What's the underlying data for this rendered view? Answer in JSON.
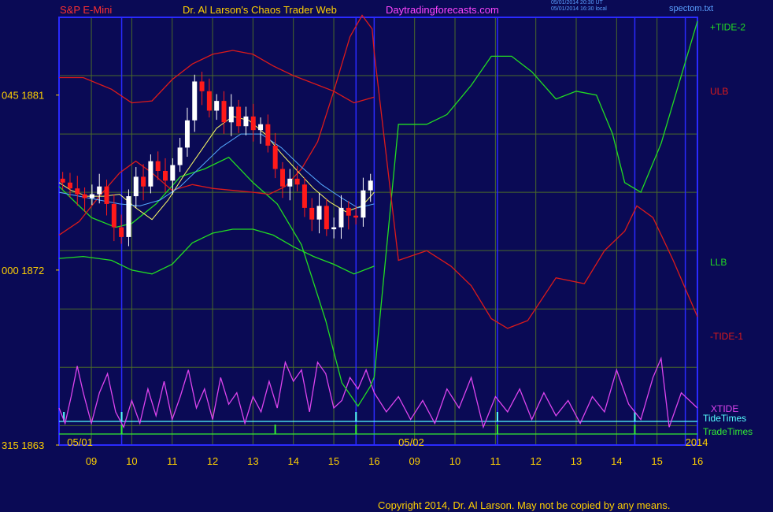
{
  "header": {
    "symbol": "S&P E-Mini",
    "site": "Dr. Al Larson's Chaos Trader Web",
    "url": "Daytradingforecasts.com",
    "stamp_ut": "05/01/2014 20:30 UT",
    "stamp_local": "05/01/2014 16:30 local",
    "file": "spectom.txt"
  },
  "copyright": "Copyright 2014, Dr. Al Larson. May not be copied by any means.",
  "colors": {
    "background": "#0a0a55",
    "frame": "#2a2aff",
    "grid": "#4a6a2a",
    "up_candle": "#ffffff",
    "down_candle": "#ff1a1a",
    "tide_plus": "#22dd22",
    "tide_minus": "#dd1a1a",
    "xtide": "#dd44ee",
    "ma_fast": "#ffff66",
    "ma_slow": "#55aaff",
    "tide_times": "#55ffff",
    "trade_times": "#33ee33",
    "header_red": "#ff3030",
    "header_yellow": "#ffd000",
    "header_magenta": "#ff44ff"
  },
  "chart_data": {
    "type": "line",
    "title": "S&P E-Mini",
    "ylabel": "",
    "ylim": [
      1863,
      1885
    ],
    "xlim": [
      8.2,
      24.0
    ],
    "y_ticks": [
      {
        "value": 1881,
        "label": "045  1881"
      },
      {
        "value": 1872,
        "label": "000  1872"
      },
      {
        "value": 1863,
        "label": "315  1863"
      }
    ],
    "x_ticks": [
      {
        "x": 9,
        "label": "09"
      },
      {
        "x": 10,
        "label": "10"
      },
      {
        "x": 11,
        "label": "11"
      },
      {
        "x": 12,
        "label": "12"
      },
      {
        "x": 13,
        "label": "13"
      },
      {
        "x": 14,
        "label": "14"
      },
      {
        "x": 15,
        "label": "15"
      },
      {
        "x": 16,
        "label": "16"
      },
      {
        "x": 17,
        "label": "09"
      },
      {
        "x": 18,
        "label": "10"
      },
      {
        "x": 19,
        "label": "11"
      },
      {
        "x": 20,
        "label": "12"
      },
      {
        "x": 21,
        "label": "13"
      },
      {
        "x": 22,
        "label": "14"
      },
      {
        "x": 23,
        "label": "15"
      },
      {
        "x": 24,
        "label": "16"
      }
    ],
    "date_labels": [
      {
        "x": 8.4,
        "label": "05/01"
      },
      {
        "x": 16.6,
        "label": "05/02"
      },
      {
        "x": 23.7,
        "label": "2014"
      }
    ],
    "right_labels": [
      {
        "text": "+TIDE-2",
        "y": 1884.5,
        "color": "#22dd22"
      },
      {
        "text": "ULB",
        "y": 1881.2,
        "color": "#dd1a1a"
      },
      {
        "text": "LLB",
        "y": 1872.4,
        "color": "#22dd22"
      },
      {
        "text": "-TIDE-1",
        "y": 1868.6,
        "color": "#dd1a1a"
      }
    ],
    "indicator_labels": [
      {
        "text": "XTIDE",
        "color": "#dd44ee"
      },
      {
        "text": "TideTimes",
        "color": "#55ffff"
      },
      {
        "text": "TradeTimes",
        "color": "#33ee33"
      }
    ],
    "grid": true,
    "price_candles_x": [
      8.2,
      16.0
    ],
    "price_close": [
      1876.5,
      1876.2,
      1875.9,
      1875.7,
      1875.9,
      1876.3,
      1875.4,
      1874.2,
      1873.7,
      1875.8,
      1876.8,
      1876.3,
      1877.6,
      1877.1,
      1876.6,
      1877.4,
      1878.3,
      1879.7,
      1881.7,
      1881.2,
      1880.2,
      1880.7,
      1879.6,
      1880.4,
      1879.4,
      1879.9,
      1879.2,
      1879.5,
      1878.4,
      1877.2,
      1876.3,
      1876.7,
      1876.4,
      1875.2,
      1874.6,
      1875.3,
      1874.1,
      1874.2,
      1875.2,
      1874.8,
      1874.7,
      1876.1,
      1876.6
    ],
    "series": [
      {
        "name": "ULB",
        "color": "#dd1a1a",
        "x": [
          8.2,
          8.8,
          9.5,
          10.0,
          10.5,
          11.0,
          11.5,
          12.0,
          12.5,
          13.0,
          13.5,
          14.0,
          14.5,
          15.0,
          15.5,
          16.0
        ],
        "values": [
          1881.9,
          1881.9,
          1881.3,
          1880.6,
          1880.7,
          1881.8,
          1882.6,
          1883.1,
          1883.3,
          1883.1,
          1882.5,
          1882.0,
          1881.6,
          1881.2,
          1880.6,
          1880.9
        ]
      },
      {
        "name": "LLB",
        "color": "#22dd22",
        "x": [
          8.2,
          8.8,
          9.5,
          10.0,
          10.5,
          11.0,
          11.5,
          12.0,
          12.5,
          13.0,
          13.5,
          14.0,
          14.5,
          15.0,
          15.5,
          16.0
        ],
        "values": [
          1872.6,
          1872.7,
          1872.5,
          1872.0,
          1871.8,
          1872.3,
          1873.4,
          1873.9,
          1874.1,
          1874.1,
          1873.8,
          1873.2,
          1872.7,
          1872.3,
          1871.8,
          1872.2
        ]
      },
      {
        "name": "+TIDE-2",
        "color": "#22dd22",
        "x": [
          8.2,
          8.6,
          9.0,
          9.6,
          10.0,
          10.6,
          11.2,
          11.8,
          12.4,
          13.0,
          13.6,
          14.2,
          14.8,
          15.2,
          15.6,
          15.9,
          16.0,
          16.6,
          17.3,
          17.8,
          18.4,
          18.9,
          19.4,
          19.9,
          20.5,
          21.0,
          21.5,
          21.9,
          22.2,
          22.6,
          23.1,
          23.6,
          24.0
        ],
        "values": [
          1876.3,
          1875.5,
          1874.7,
          1874.2,
          1874.4,
          1875.4,
          1876.8,
          1877.2,
          1877.8,
          1876.5,
          1875.4,
          1873.3,
          1869.4,
          1866.2,
          1865.0,
          1866.0,
          1866.5,
          1879.5,
          1879.5,
          1880.0,
          1881.5,
          1883.0,
          1883.0,
          1882.2,
          1880.8,
          1881.2,
          1881.0,
          1879.0,
          1876.5,
          1876.0,
          1878.5,
          1882.0,
          1884.8
        ]
      },
      {
        "name": "-TIDE-1",
        "color": "#dd1a1a",
        "x": [
          8.2,
          8.7,
          9.2,
          9.7,
          10.1,
          10.5,
          11.0,
          11.5,
          12.0,
          12.5,
          13.0,
          13.4,
          13.8,
          14.2,
          14.6,
          15.0,
          15.4,
          15.7,
          15.95,
          16.0,
          16.6,
          17.3,
          17.9,
          18.4,
          18.9,
          19.3,
          19.8,
          20.5,
          21.2,
          21.7,
          22.2,
          22.5,
          22.9,
          23.4,
          24.0
        ],
        "values": [
          1873.8,
          1874.5,
          1875.8,
          1877.0,
          1877.6,
          1877.0,
          1876.1,
          1876.4,
          1876.2,
          1876.1,
          1876.0,
          1875.9,
          1876.3,
          1877.2,
          1878.6,
          1881.2,
          1884.0,
          1885.1,
          1884.4,
          1883.2,
          1872.5,
          1873.0,
          1872.2,
          1871.2,
          1869.5,
          1869.0,
          1869.4,
          1871.6,
          1871.3,
          1873.0,
          1874.0,
          1875.3,
          1874.7,
          1872.5,
          1869.6
        ]
      },
      {
        "name": "MA fast",
        "color": "#ffff66",
        "x": [
          8.2,
          8.5,
          8.9,
          9.3,
          9.7,
          10.1,
          10.5,
          10.9,
          11.3,
          11.7,
          12.1,
          12.5,
          12.9,
          13.3,
          13.7,
          14.1,
          14.5,
          14.9,
          15.3,
          15.7,
          16.0
        ],
        "values": [
          1876.5,
          1876.1,
          1875.8,
          1875.8,
          1875.9,
          1875.2,
          1874.6,
          1875.6,
          1876.9,
          1878.1,
          1879.3,
          1879.9,
          1879.7,
          1879.0,
          1878.0,
          1877.1,
          1876.2,
          1875.5,
          1875.0,
          1875.3,
          1876.0
        ]
      },
      {
        "name": "MA slow",
        "color": "#55aaff",
        "x": [
          8.2,
          8.7,
          9.2,
          9.7,
          10.2,
          10.7,
          11.2,
          11.7,
          12.2,
          12.7,
          13.2,
          13.7,
          14.2,
          14.7,
          15.2,
          15.6,
          16.0
        ],
        "values": [
          1876.0,
          1875.8,
          1875.6,
          1875.4,
          1875.3,
          1875.6,
          1876.3,
          1877.3,
          1878.3,
          1879.0,
          1879.0,
          1878.3,
          1877.3,
          1876.4,
          1875.7,
          1875.2,
          1875.4
        ]
      }
    ],
    "xtide": {
      "name": "XTIDE",
      "x": [
        8.2,
        8.35,
        8.5,
        8.65,
        8.8,
        9.0,
        9.2,
        9.4,
        9.6,
        9.8,
        10.0,
        10.2,
        10.4,
        10.6,
        10.8,
        11.0,
        11.2,
        11.4,
        11.6,
        11.8,
        12.0,
        12.2,
        12.4,
        12.6,
        12.8,
        13.0,
        13.2,
        13.4,
        13.6,
        13.8,
        14.0,
        14.2,
        14.4,
        14.6,
        14.8,
        15.0,
        15.2,
        15.4,
        15.6,
        15.8,
        16.0,
        16.3,
        16.6,
        16.9,
        17.2,
        17.5,
        17.8,
        18.1,
        18.4,
        18.7,
        19.0,
        19.3,
        19.6,
        19.9,
        20.2,
        20.5,
        20.8,
        21.1,
        21.4,
        21.7,
        22.0,
        22.3,
        22.6,
        22.9,
        23.1,
        23.3,
        23.6,
        24.0
      ],
      "values": [
        0.35,
        0.15,
        0.5,
        0.9,
        0.55,
        0.15,
        0.55,
        0.8,
        0.3,
        0.1,
        0.45,
        0.15,
        0.6,
        0.25,
        0.7,
        0.2,
        0.5,
        0.85,
        0.35,
        0.6,
        0.2,
        0.75,
        0.4,
        0.55,
        0.15,
        0.5,
        0.3,
        0.7,
        0.35,
        0.95,
        0.7,
        0.85,
        0.3,
        0.95,
        0.8,
        0.35,
        0.45,
        0.75,
        0.6,
        0.85,
        0.55,
        0.3,
        0.5,
        0.2,
        0.45,
        0.15,
        0.6,
        0.35,
        0.75,
        0.1,
        0.5,
        0.3,
        0.6,
        0.2,
        0.55,
        0.25,
        0.45,
        0.15,
        0.5,
        0.3,
        0.85,
        0.4,
        0.2,
        0.75,
        1.0,
        0.1,
        0.55,
        0.35
      ]
    },
    "tide_time_marks": [
      8.32,
      9.75,
      15.55,
      19.05,
      22.45
    ],
    "trade_time_marks": [
      9.75,
      13.55,
      15.55,
      19.05,
      22.45
    ],
    "vertical_markers": [
      {
        "x": 8.2,
        "color": "#2a2aff"
      },
      {
        "x": 9.75,
        "color": "#2a2aff"
      },
      {
        "x": 15.55,
        "color": "#2a2aff"
      },
      {
        "x": 16.0,
        "color": "#2a2aff"
      },
      {
        "x": 19.05,
        "color": "#2a2aff"
      },
      {
        "x": 22.45,
        "color": "#2a2aff"
      },
      {
        "x": 23.7,
        "color": "#2a2aff"
      }
    ]
  }
}
